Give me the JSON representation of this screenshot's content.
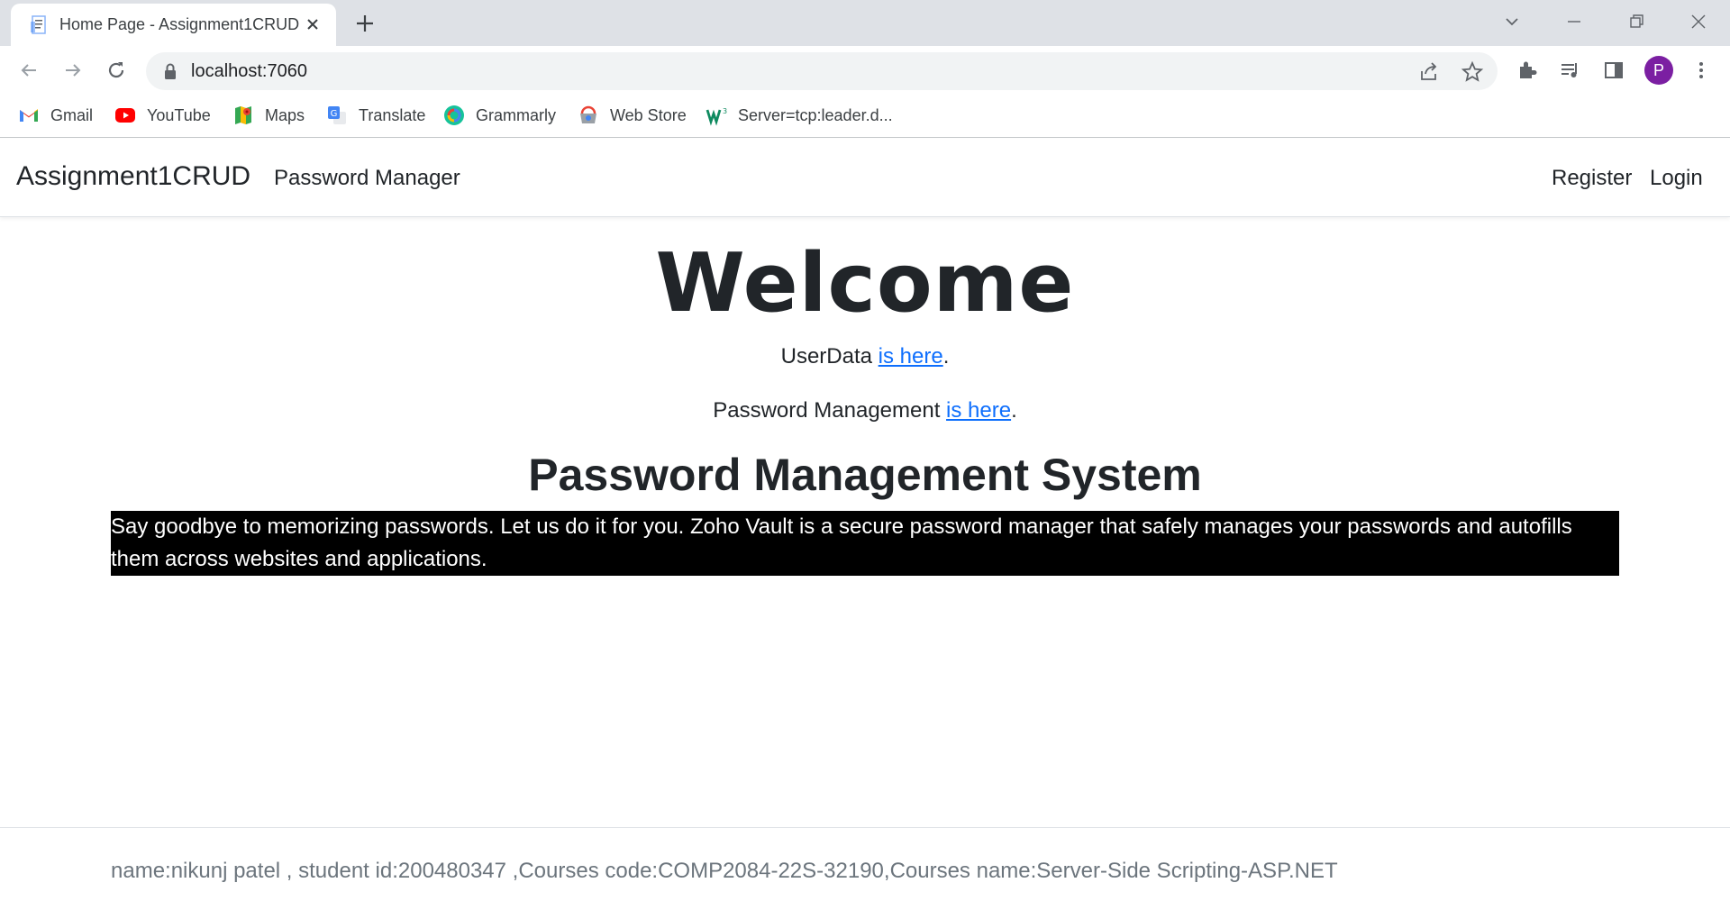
{
  "browser": {
    "tab_title": "Home Page - Assignment1CRUD",
    "url": "localhost:7060",
    "profile_initial": "P",
    "bookmarks": [
      {
        "label": "Gmail",
        "icon": "gmail-icon"
      },
      {
        "label": "YouTube",
        "icon": "youtube-icon"
      },
      {
        "label": "Maps",
        "icon": "maps-icon"
      },
      {
        "label": "Translate",
        "icon": "translate-icon"
      },
      {
        "label": "Grammarly",
        "icon": "grammarly-icon"
      },
      {
        "label": "Web Store",
        "icon": "webstore-icon"
      },
      {
        "label": "Server=tcp:leader.d...",
        "icon": "server-icon"
      }
    ]
  },
  "navbar": {
    "brand": "Assignment1CRUD",
    "password_manager": "Password Manager",
    "register": "Register",
    "login": "Login"
  },
  "main": {
    "welcome": "Welcome",
    "userdata_prefix": "UserData ",
    "userdata_link": "is here",
    "userdata_suffix": ".",
    "pm_prefix": "Password Management ",
    "pm_link": "is here",
    "pm_suffix": ".",
    "heading": "Password Management System",
    "description": "Say goodbye to memorizing passwords. Let us do it for you. Zoho Vault is a secure password manager that safely manages your passwords and autofills them across websites and applications."
  },
  "footer": {
    "text": "name:nikunj patel , student id:200480347 ,Courses code:COMP2084-22S-32190,Courses name:Server-Side Scripting-ASP.NET"
  },
  "colors": {
    "link": "#0d6efd",
    "description_bg": "#000000",
    "avatar": "#7b1fa2"
  }
}
